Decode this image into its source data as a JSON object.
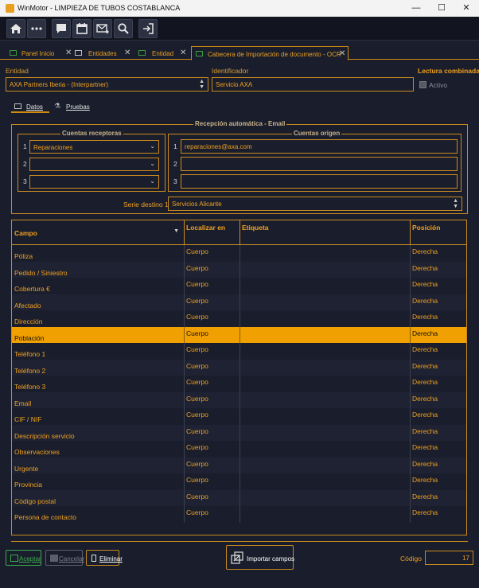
{
  "window": {
    "title": "WinMotor - LIMPIEZA DE TUBOS COSTABLANCA",
    "minimize": "—",
    "maximize": "☐",
    "close": "✕"
  },
  "tabs": [
    {
      "label": "Panel Inicio"
    },
    {
      "label": "Entidades"
    },
    {
      "label": "Entidad"
    },
    {
      "label": "Cabecera de Importación de documento - OCR"
    }
  ],
  "tab_close": "✕",
  "header": {
    "entidad_label": "Entidad",
    "entidad_value": "AXA Partners Iberia - (Interpartner)",
    "identificador_label": "Identificador",
    "identificador_value": "Servicio AXA",
    "lectura_label": "Lectura combinada",
    "activo_label": "Activo"
  },
  "subtabs": {
    "datos": "Datos",
    "pruebas": "Pruebas"
  },
  "recepcion": {
    "title": "Recepción automática - Email",
    "receptoras_title": "Cuentas receptoras",
    "origen_title": "Cuentas origen",
    "row_numbers": [
      "1",
      "2",
      "3"
    ],
    "receptoras": [
      "Reparaciones",
      "",
      ""
    ],
    "origen": [
      "reparaciones@axa.com",
      "",
      ""
    ],
    "serie_label": "Serie destino 1",
    "serie_value": "Servicios Alicante"
  },
  "grid": {
    "headers": {
      "campo": "Campo",
      "localizar": "Localizar en",
      "etiqueta": "Etiqueta",
      "posicion": "Posición"
    },
    "rows": [
      {
        "campo": "Póliza",
        "localizar": "Cuerpo",
        "etiqueta": "",
        "posicion": "Derecha"
      },
      {
        "campo": "Pedido / Siniestro",
        "localizar": "Cuerpo",
        "etiqueta": "",
        "posicion": "Derecha"
      },
      {
        "campo": "Cobertura €",
        "localizar": "Cuerpo",
        "etiqueta": "",
        "posicion": "Derecha"
      },
      {
        "campo": "Afectado",
        "localizar": "Cuerpo",
        "etiqueta": "",
        "posicion": "Derecha"
      },
      {
        "campo": "Dirección",
        "localizar": "Cuerpo",
        "etiqueta": "",
        "posicion": "Derecha"
      },
      {
        "campo": "Población",
        "localizar": "Cuerpo",
        "etiqueta": "",
        "posicion": "Derecha"
      },
      {
        "campo": "Teléfono 1",
        "localizar": "Cuerpo",
        "etiqueta": "",
        "posicion": "Derecha"
      },
      {
        "campo": "Teléfono 2",
        "localizar": "Cuerpo",
        "etiqueta": "",
        "posicion": "Derecha"
      },
      {
        "campo": "Teléfono 3",
        "localizar": "Cuerpo",
        "etiqueta": "",
        "posicion": "Derecha"
      },
      {
        "campo": "Email",
        "localizar": "Cuerpo",
        "etiqueta": "",
        "posicion": "Derecha"
      },
      {
        "campo": "CIF / NIF",
        "localizar": "Cuerpo",
        "etiqueta": "",
        "posicion": "Derecha"
      },
      {
        "campo": "Descripción servicio",
        "localizar": "Cuerpo",
        "etiqueta": "",
        "posicion": "Derecha"
      },
      {
        "campo": "Observaciones",
        "localizar": "Cuerpo",
        "etiqueta": "",
        "posicion": "Derecha"
      },
      {
        "campo": "Urgente",
        "localizar": "Cuerpo",
        "etiqueta": "",
        "posicion": "Derecha"
      },
      {
        "campo": "Provincia",
        "localizar": "Cuerpo",
        "etiqueta": "",
        "posicion": "Derecha"
      },
      {
        "campo": "Código postal",
        "localizar": "Cuerpo",
        "etiqueta": "",
        "posicion": "Derecha"
      },
      {
        "campo": "Persona de contacto",
        "localizar": "Cuerpo",
        "etiqueta": "",
        "posicion": "Derecha"
      }
    ],
    "selected_row": "Población"
  },
  "footer": {
    "aceptar": "Aceptar",
    "cancelar": "Cancelar",
    "eliminar": "Eliminar",
    "importar": "Importar campos",
    "codigo_label": "Código",
    "codigo_value": "17"
  },
  "colors": {
    "accent": "#f0a020",
    "background": "#1a1e2c",
    "selection": "#f0a000"
  }
}
